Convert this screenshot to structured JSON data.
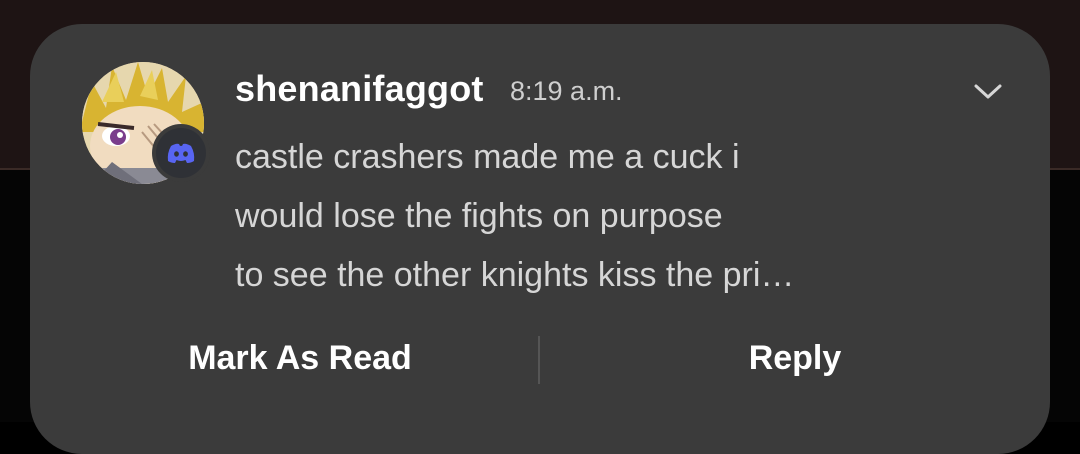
{
  "notification": {
    "sender": "shenanifaggot",
    "time": "8:19 a.m.",
    "message_lines": [
      "castle crashers made me a cuck i",
      "would lose the fights on purpose",
      "to see the other knights kiss the pri…"
    ],
    "actions": {
      "mark_as_read": "Mark As Read",
      "reply": "Reply"
    },
    "icons": {
      "app_badge": "discord-icon",
      "expand": "chevron-down-icon"
    }
  },
  "colors": {
    "card_background": "#3b3b3b",
    "sender_text": "#ffffff",
    "message_text": "#d6d6d6",
    "badge_background": "#2f3136",
    "badge_icon": "#5865f2"
  }
}
